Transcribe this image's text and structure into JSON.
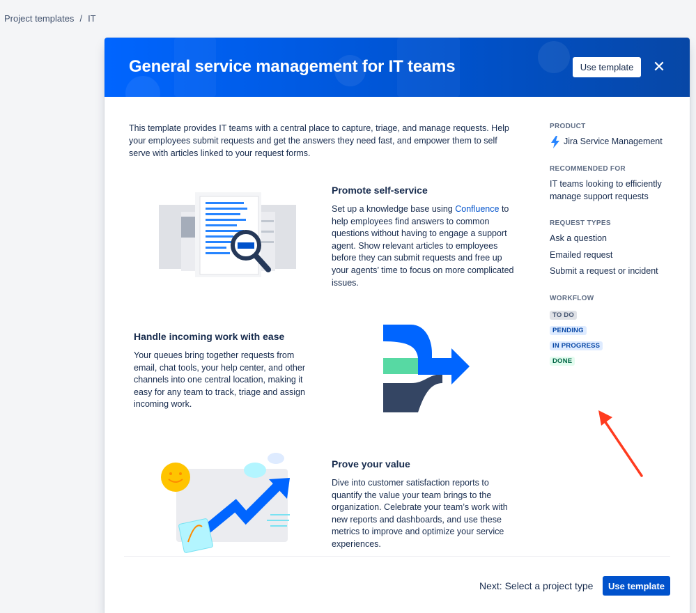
{
  "breadcrumb": {
    "root": "Project templates",
    "separator": "/",
    "current": "IT"
  },
  "modal": {
    "title": "General service management for IT teams",
    "use_template_label": "Use template",
    "close_icon": "close-icon",
    "description": "This template provides IT teams with a central place to capture, triage, and manage requests. Help your employees submit requests and get the answers they need fast, and empower them to self serve with articles linked to your request forms."
  },
  "features": [
    {
      "title": "Promote self-service",
      "body_before_link": "Set up a knowledge base using ",
      "link": "Confluence",
      "body_after_link": " to help employees find answers to common questions without having to engage a support agent. Show relevant articles to employees before they can submit requests and free up your agents’ time to focus on more complicated issues.",
      "illustration": "document-search-illustration"
    },
    {
      "title": "Handle incoming work with ease",
      "body": "Your queues bring together requests from email, chat tools, your help center, and other channels into one central location, making it easy for any team to track, triage and assign incoming work.",
      "illustration": "merge-arrows-illustration"
    },
    {
      "title": "Prove your value",
      "body": "Dive into customer satisfaction reports to quantify the value your team brings to the organization. Celebrate your team’s work with new reports and dashboards, and use these metrics to improve and optimize your service experiences.",
      "illustration": "growth-chart-illustration"
    }
  ],
  "sidebar": {
    "product_label": "PRODUCT",
    "product_name": "Jira Service Management",
    "product_icon": "jira-service-management-icon",
    "recommended_label": "RECOMMENDED FOR",
    "recommended_text": "IT teams looking to efficiently manage support requests",
    "request_types_label": "REQUEST TYPES",
    "request_types": [
      "Ask a question",
      "Emailed request",
      "Submit a request or incident"
    ],
    "workflow_label": "WORKFLOW",
    "workflow": [
      "TO DO",
      "PENDING",
      "IN PROGRESS",
      "DONE"
    ]
  },
  "footer": {
    "next_text": "Next: Select a project type",
    "use_template_label": "Use template"
  },
  "colors": {
    "header_blue": "#0052cc",
    "primary_button": "#0052cc",
    "annotation_arrow": "#ff3b1f"
  }
}
